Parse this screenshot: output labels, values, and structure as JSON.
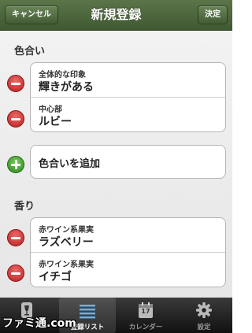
{
  "nav": {
    "cancel_label": "キャンセル",
    "title": "新規登録",
    "done_label": "決定"
  },
  "color_section": {
    "title": "色合い",
    "items": [
      {
        "label": "全体的な印象",
        "value": "輝きがある"
      },
      {
        "label": "中心部",
        "value": "ルビー"
      }
    ],
    "add_label": "色合いを追加"
  },
  "aroma_section": {
    "title": "香り",
    "items": [
      {
        "label": "赤ワイン系果実",
        "value": "ラズベリー"
      },
      {
        "label": "赤ワイン系果実",
        "value": "イチゴ"
      }
    ]
  },
  "tabs": [
    {
      "label": "",
      "icon": "wine-glass-icon"
    },
    {
      "label": "登録リスト",
      "icon": "list-icon",
      "active": true
    },
    {
      "label": "カレンダー",
      "icon": "calendar-icon",
      "date": "17"
    },
    {
      "label": "設定",
      "icon": "gear-icon"
    }
  ],
  "watermark": "ファミ通.com",
  "colors": {
    "nav_green": "#4b6639",
    "minus_red": "#c62828",
    "plus_green": "#3a9a23"
  }
}
